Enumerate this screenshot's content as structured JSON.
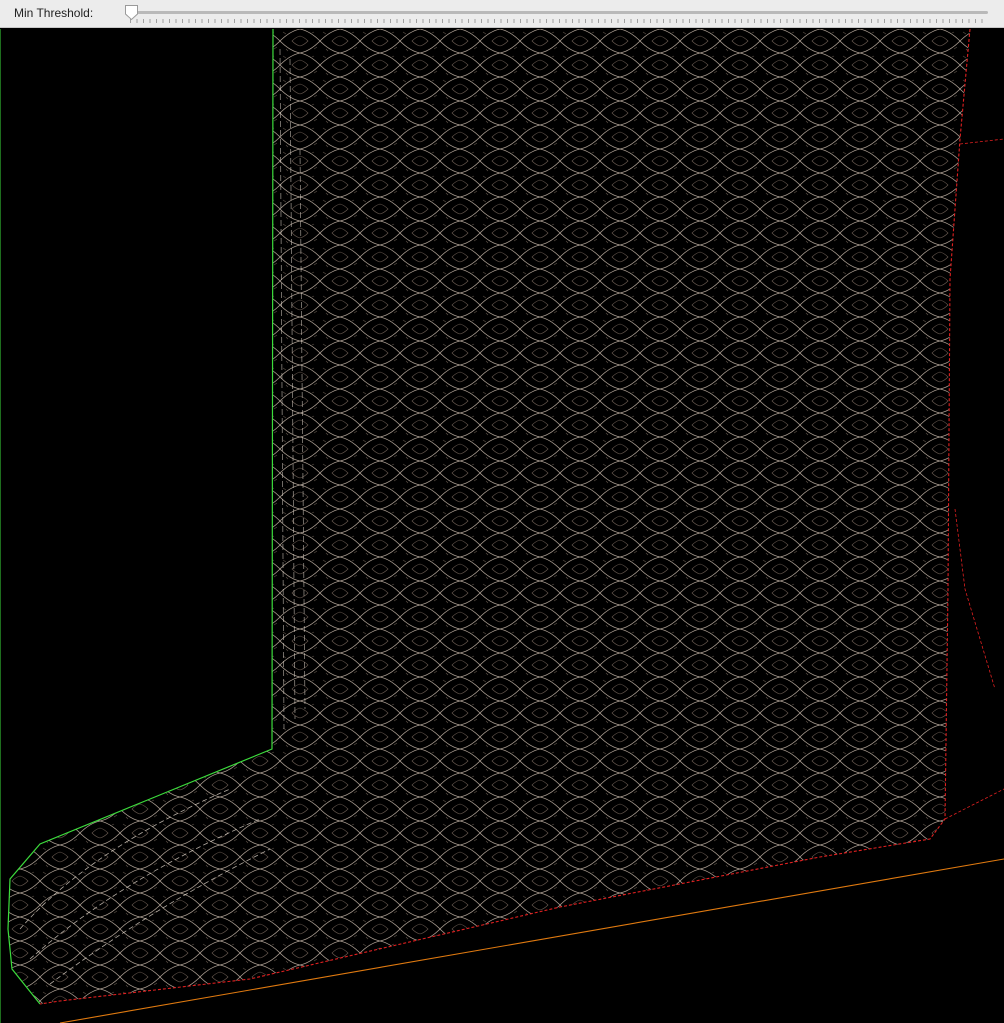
{
  "toolbar": {
    "slider": {
      "label": "Min Threshold:",
      "value_fraction": 0.0,
      "thumb_icon": "slider-thumb-icon"
    }
  },
  "viewport": {
    "content": "edge-detection-output",
    "colors": {
      "background": "#000000",
      "edge_outline_left": "#3cdc3c",
      "edge_outline_right": "#e02020",
      "baseline": "#e07a10",
      "texture": "#c9b9a8"
    }
  }
}
